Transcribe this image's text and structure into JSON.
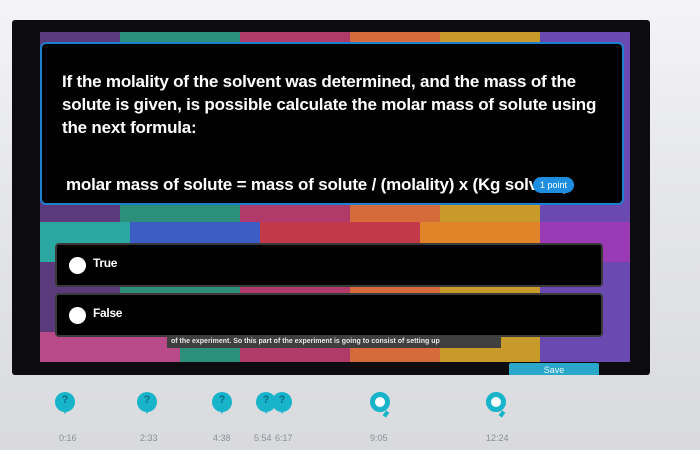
{
  "question": {
    "text": "If the molality of the solvent was determined, and the mass of the solute is given, is possible calculate the molar mass of solute using the next formula:",
    "formula": "molar mass of solute = mass of solute / (molality) x (Kg solvent)",
    "points_badge": "1 point"
  },
  "options": [
    {
      "label": "True"
    },
    {
      "label": "False"
    }
  ],
  "caption": "of the experiment. So this part of the experiment is going to consist of setting up",
  "save_label": "Save",
  "timeline": {
    "markers": [
      {
        "type": "question",
        "glyph": "?"
      },
      {
        "type": "question",
        "glyph": "?"
      },
      {
        "type": "question",
        "glyph": "?"
      },
      {
        "type": "question",
        "glyph": "?"
      },
      {
        "type": "question",
        "glyph": "?"
      },
      {
        "type": "ring"
      },
      {
        "type": "ring"
      }
    ],
    "times": [
      "0:16",
      "2:33",
      "4:38",
      "5:54",
      "6:17",
      "9:05",
      "12:24"
    ]
  },
  "colors": {
    "accent": "#17b4ca",
    "card_border": "#1d7fd0",
    "badge": "#1e8fe0"
  }
}
